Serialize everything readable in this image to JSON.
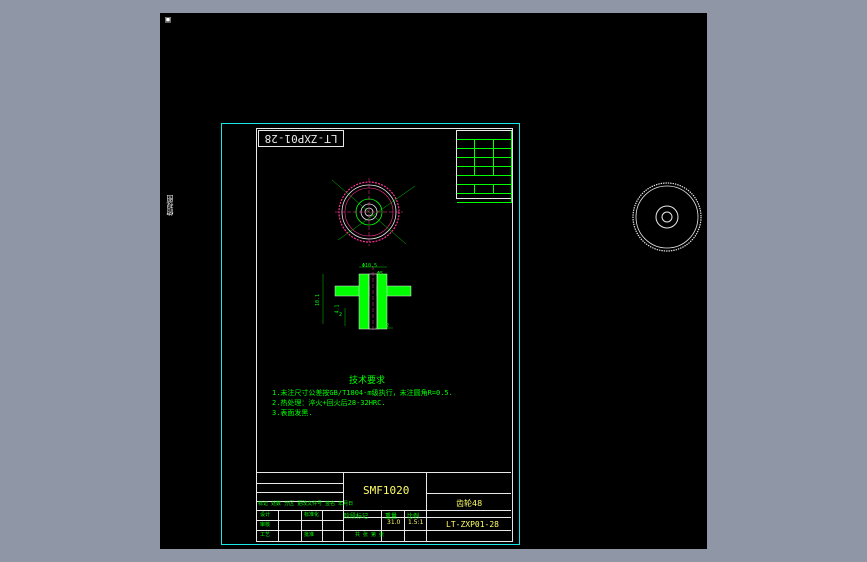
{
  "viewport": {
    "side_icon": "cube-icon",
    "side_label": "俯视图",
    "background_color": "#000000",
    "frame_color": "#19e6e6",
    "drawing_color": "#00ff00"
  },
  "drawing": {
    "stamp_label": "LT-ZXP01-28",
    "tech_title": "技术要求",
    "tech_lines": [
      "1.未注尺寸公差按GB/T1804-m级执行，未注圆角R=0.5.",
      "2.热处理：淬火+回火后28-32HRC.",
      "3.表面发黑."
    ],
    "dims": {
      "top_dia": "Φ10.5",
      "hole_dia": "Φ5",
      "bottom_dia": "Φ12",
      "height_total": "10.1",
      "height_part": "4.1",
      "height_small": "2"
    }
  },
  "title_block": {
    "material": "SMF1020",
    "part_name": "齿轮48",
    "drawing_number": "LT-ZXP01-28",
    "row_labels": [
      "标记",
      "处数",
      "分区",
      "更改文件号",
      "签名",
      "年月日"
    ],
    "role_labels": [
      "设计",
      "审核",
      "工艺",
      "批准"
    ],
    "stage_header": "阶段标记",
    "weight_header": "重量",
    "scale_header": "比例",
    "weight": "31.0",
    "scale": "1.5:1",
    "standard": "标准化",
    "sheet": "共 张 第 张"
  }
}
